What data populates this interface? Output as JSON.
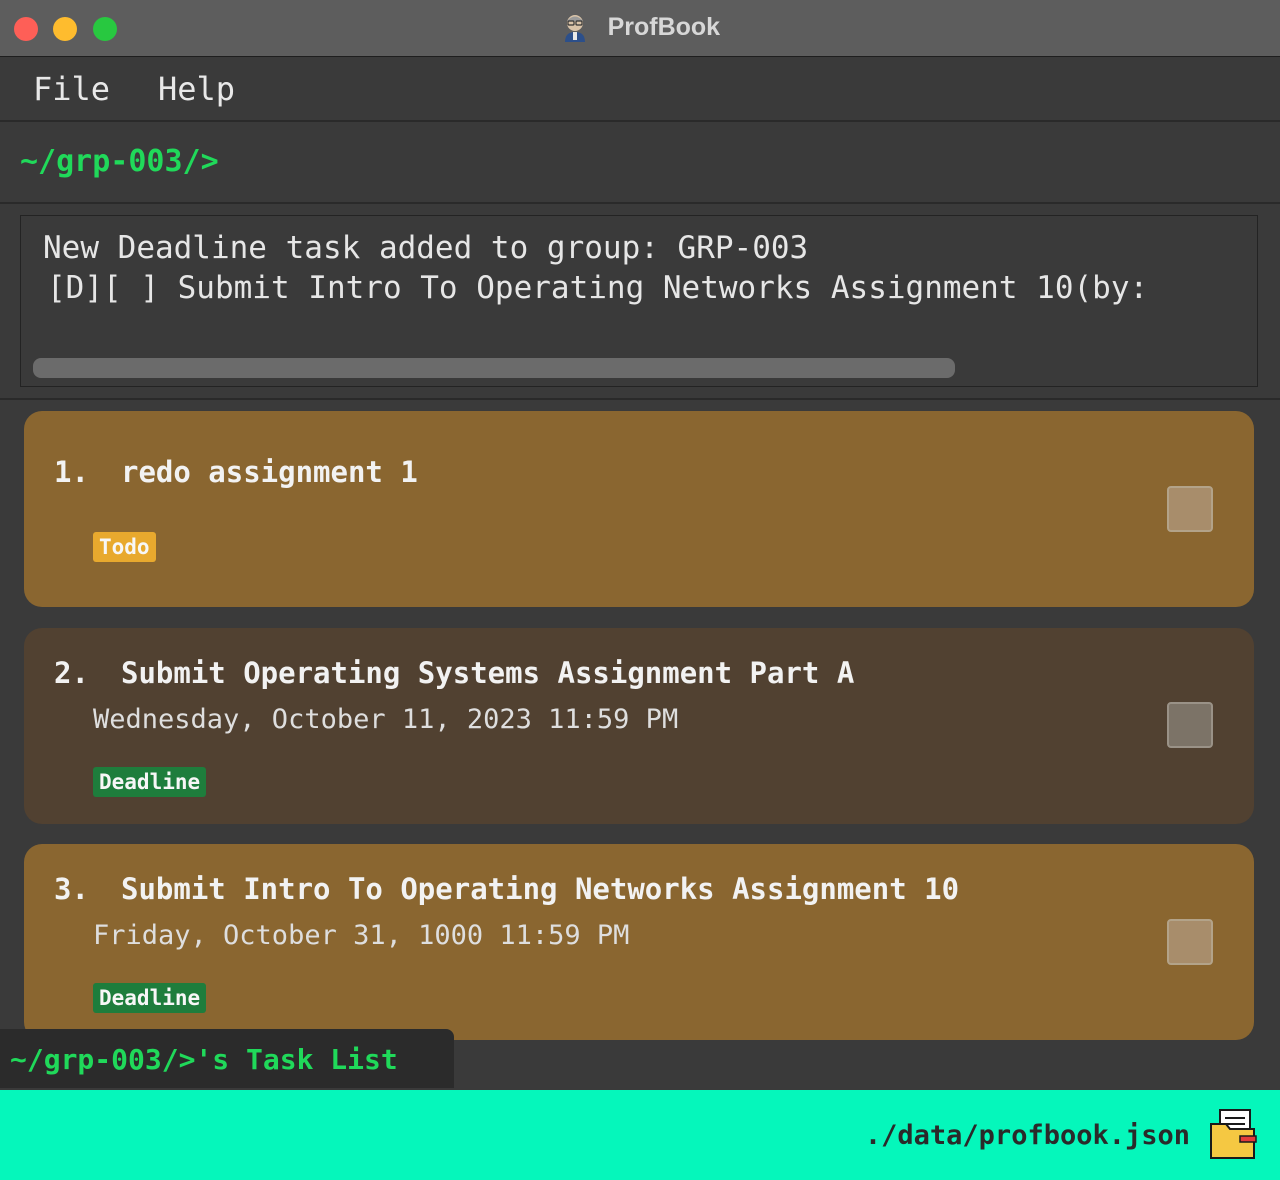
{
  "window": {
    "title": "ProfBook",
    "app_icon": "professor-avatar-icon"
  },
  "menu": {
    "file": "File",
    "help": "Help"
  },
  "command": {
    "path": "~/grp-003/>"
  },
  "result": {
    "line1": "New Deadline task added to group: GRP-003",
    "line2": "[D][ ] Submit Intro To Operating Networks Assignment 10(by:"
  },
  "tasks": [
    {
      "index": "1.",
      "title": "redo assignment 1",
      "date": "",
      "tag": "Todo",
      "done": false
    },
    {
      "index": "2.",
      "title": "Submit Operating Systems Assignment Part A",
      "date": "Wednesday, October 11, 2023 11:59 PM",
      "tag": "Deadline",
      "done": false
    },
    {
      "index": "3.",
      "title": "Submit Intro To Operating Networks Assignment 10",
      "date": "Friday, October 31, 1000 11:59 PM",
      "tag": "Deadline",
      "done": false
    }
  ],
  "list_label": "~/grp-003/>'s Task List",
  "status": {
    "path": "./data/profbook.json",
    "icon": "folder-icon"
  },
  "colors": {
    "accent_green": "#20d95a",
    "statusbar": "#05f7bb",
    "todo_card": "#8a6630",
    "deadline_card_dark": "#514131",
    "todo_tag": "#e8a92e",
    "deadline_tag": "#1e7d3c"
  }
}
